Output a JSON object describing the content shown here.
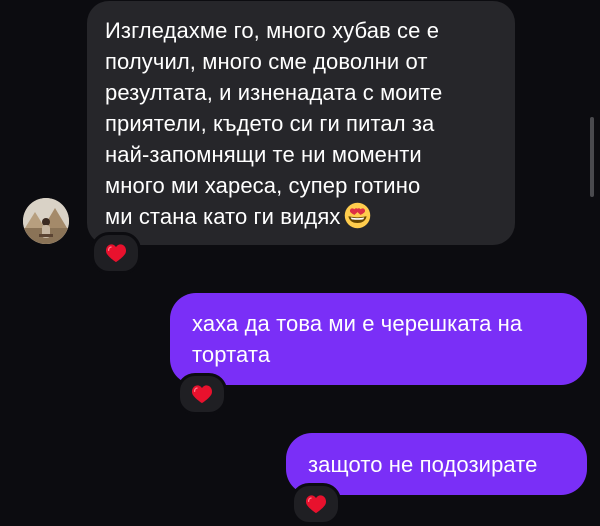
{
  "messages": [
    {
      "direction": "incoming",
      "lines": [
        "Изгледахме го, много хубав се е",
        "получил, много сме доволни от",
        "резултата, и изненадата с моите",
        "приятели, където си ги питал за",
        "най-запомнящи те ни моменти",
        "много ми хареса, супер готино",
        "ми стана като ги видях"
      ],
      "emoji": "smiling-face-with-heart-eyes",
      "reaction": "red-heart"
    },
    {
      "direction": "outgoing",
      "lines": [
        "хаха да това ми е черешката на",
        "тортата"
      ],
      "reaction": "red-heart"
    },
    {
      "direction": "outgoing",
      "lines": [
        "защото не подозирате"
      ],
      "reaction": "red-heart"
    }
  ],
  "colors": {
    "background": "#0c0c10",
    "incoming_bubble": "#26262a",
    "outgoing_bubble": "#7a2ff7",
    "text": "#ffffff",
    "heart": "#e8112d"
  }
}
